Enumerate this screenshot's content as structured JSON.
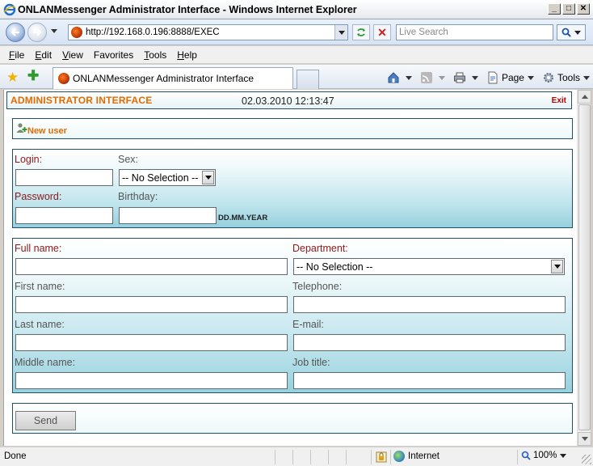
{
  "window": {
    "title": "ONLANMessenger Administrator Interface - Windows Internet Explorer",
    "minimize": "_",
    "maximize": "□",
    "close": "✕"
  },
  "address_bar": {
    "url": "http://192.168.0.196:8888/EXEC",
    "search_placeholder": "Live Search"
  },
  "menu": {
    "items": [
      {
        "accel": "F",
        "rest": "ile"
      },
      {
        "accel": "E",
        "rest": "dit"
      },
      {
        "accel": "V",
        "rest": "iew"
      },
      {
        "accel": "F",
        "rest": "avorites",
        "label": "Favorites"
      },
      {
        "accel": "T",
        "rest": "ools"
      },
      {
        "accel": "H",
        "rest": "elp"
      }
    ]
  },
  "tabs": {
    "active_label": "ONLANMessenger Administrator Interface"
  },
  "command_bar": {
    "page_label": "Page",
    "tools_label": "Tools"
  },
  "header": {
    "title": "ADMINISTRATOR INTERFACE",
    "datetime": "02.03.2010 12:13:47",
    "exit_label": "Exit"
  },
  "new_user": {
    "label": "New user"
  },
  "login_form": {
    "login_label": "Login:",
    "sex_label": "Sex:",
    "sex_value": "-- No Selection --",
    "password_label": "Password:",
    "birthday_label": "Birthday:",
    "birthday_format": "DD.MM.YEAR"
  },
  "details_form": {
    "full_name_label": "Full name:",
    "department_label": "Department:",
    "department_value": "-- No Selection --",
    "first_name_label": "First name:",
    "telephone_label": "Telephone:",
    "last_name_label": "Last name:",
    "email_label": "E-mail:",
    "middle_name_label": "Middle name:",
    "job_title_label": "Job title:"
  },
  "send": {
    "label": "Send"
  },
  "status": {
    "text": "Done",
    "zone": "Internet",
    "zoom": "100%"
  },
  "colors": {
    "accent_orange": "#e36b00",
    "required_label": "#8b1a1a",
    "panel_border": "#1f4f6a",
    "panel_gradient_bottom": "#96d1de"
  }
}
